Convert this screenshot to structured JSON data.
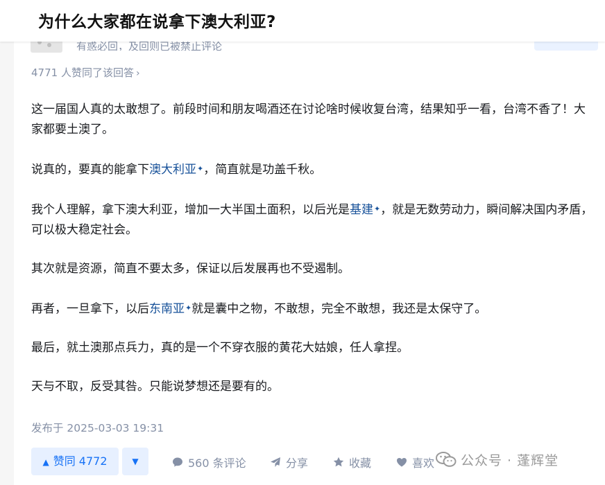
{
  "question": {
    "title": "为什么大家都在说拿下澳大利亚?"
  },
  "answer": {
    "comment_note": "有惑必回，及回则已被禁止评论",
    "likes_summary": "4771 人赞同了该回答",
    "paragraphs": [
      {
        "segments": [
          {
            "text": "这一届国人真的太敢想了。前段时间和朋友喝酒还在讨论啥时候收复台湾，结果知乎一看，台湾不香了！大家都要土澳了。"
          }
        ]
      },
      {
        "segments": [
          {
            "text": "说真的，要真的能拿下"
          },
          {
            "text": "澳大利亚",
            "link": true
          },
          {
            "text": "，简直就是功盖千秋。"
          }
        ]
      },
      {
        "segments": [
          {
            "text": "我个人理解，拿下澳大利亚，增加一大半国土面积，以后光是"
          },
          {
            "text": "基建",
            "link": true
          },
          {
            "text": "，就是无数劳动力，瞬间解决国内矛盾，可以极大稳定社会。"
          }
        ]
      },
      {
        "segments": [
          {
            "text": "其次就是资源，简直不要太多，保证以后发展再也不受遏制。"
          }
        ]
      },
      {
        "segments": [
          {
            "text": "再者，一旦拿下，以后"
          },
          {
            "text": "东南亚",
            "link": true
          },
          {
            "text": "就是囊中之物，不敢想，完全不敢想，我还是太保守了。"
          }
        ]
      },
      {
        "segments": [
          {
            "text": "最后，就土澳那点兵力，真的是一个不穿衣服的黄花大姑娘，任人拿捏。"
          }
        ]
      },
      {
        "segments": [
          {
            "text": "天与不取，反受其咎。只能说梦想还是要有的。"
          }
        ]
      }
    ],
    "published": "发布于 2025-03-03 19:31"
  },
  "actions": {
    "vote_up": "赞同 4772",
    "vote_up_icon": "▲",
    "vote_down_icon": "▼",
    "comments": "560 条评论",
    "share": "分享",
    "favorite": "收藏",
    "like": "喜欢"
  },
  "watermark": {
    "text": "公众号 · 蓬辉堂"
  },
  "colors": {
    "link": "#175199",
    "accent": "#1772f6",
    "muted": "#8590a6",
    "vote_bg": "#e7f0ff"
  },
  "icons": {
    "link_marker": "✦"
  }
}
